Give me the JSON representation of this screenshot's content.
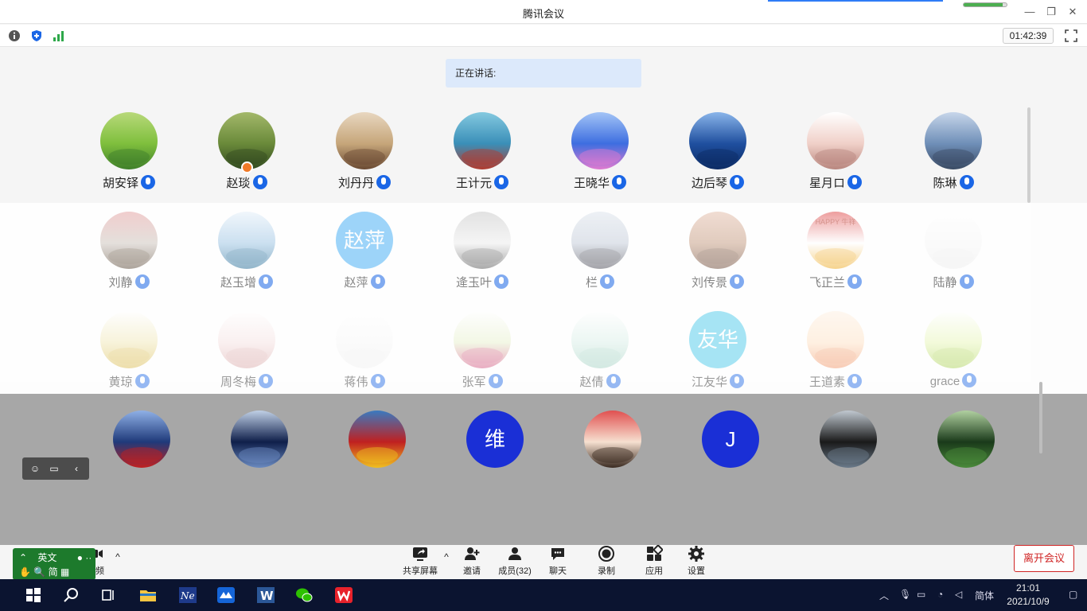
{
  "window": {
    "title": "腾讯会议",
    "network_level": 0.9,
    "timer": "01:42:39"
  },
  "speaking": {
    "label": "正在讲话:"
  },
  "participants_row1": [
    {
      "name": "胡安铎",
      "avatar": "landscape-green"
    },
    {
      "name": "赵琰",
      "avatar": "topiary",
      "host": true
    },
    {
      "name": "刘丹丹",
      "avatar": "child-drinking"
    },
    {
      "name": "王计元",
      "avatar": "bridge"
    },
    {
      "name": "王晓华",
      "avatar": "flowers"
    },
    {
      "name": "边后琴",
      "avatar": "lake-city"
    },
    {
      "name": "星月ロ",
      "avatar": "baby"
    },
    {
      "name": "陈琳",
      "avatar": "city-view"
    }
  ],
  "participants_row2": [
    {
      "name": "刘静",
      "avatar": "woman-window"
    },
    {
      "name": "赵玉增",
      "avatar": "lake"
    },
    {
      "name": "赵萍",
      "avatar_text": "赵萍",
      "color": "#4fb3f6"
    },
    {
      "name": "逄玉叶",
      "avatar": "jumping"
    },
    {
      "name": "栏",
      "avatar": "temple"
    },
    {
      "name": "刘传景",
      "avatar": "kids"
    },
    {
      "name": "飞正兰",
      "avatar": "happy-cake",
      "badge_text": "HAPPY 牛祥"
    },
    {
      "name": "陆静",
      "avatar": "blank"
    }
  ],
  "participants_row3": [
    {
      "name": "黄琼",
      "avatar": "elder"
    },
    {
      "name": "周冬梅",
      "avatar": "girl"
    },
    {
      "name": "蒋伟",
      "avatar": "blank"
    },
    {
      "name": "张军",
      "avatar": "person-standing"
    },
    {
      "name": "赵倩",
      "avatar": "beach"
    },
    {
      "name": "江友华",
      "avatar_text": "友华",
      "color": "#3cc6e8"
    },
    {
      "name": "王道素",
      "avatar": "couple"
    },
    {
      "name": "grace",
      "avatar": "green-light"
    }
  ],
  "participants_row4": [
    {
      "avatar": "sky-red"
    },
    {
      "avatar": "beach-night"
    },
    {
      "avatar": "playground"
    },
    {
      "avatar_text": "维",
      "color": "#1a2fd6"
    },
    {
      "avatar": "cartoon-girl"
    },
    {
      "avatar_text": "J",
      "color": "#1a2fd6"
    },
    {
      "avatar": "clouds-dark"
    },
    {
      "avatar": "green-plant"
    }
  ],
  "controls": {
    "video_label": "视频",
    "share_label": "共享屏幕",
    "invite_label": "邀请",
    "members_label": "成员(32)",
    "chat_label": "聊天",
    "record_label": "录制",
    "apps_label": "应用",
    "settings_label": "设置",
    "leave_label": "离开会议"
  },
  "ime": {
    "lang": "英文",
    "mode": "简"
  },
  "taskbar": {
    "ime_lang": "简体",
    "time": "21:01",
    "date": "2021/10/9"
  },
  "colors": {
    "accent": "#1a66e6",
    "leave": "#d02424",
    "taskbar": "#0b1430"
  }
}
